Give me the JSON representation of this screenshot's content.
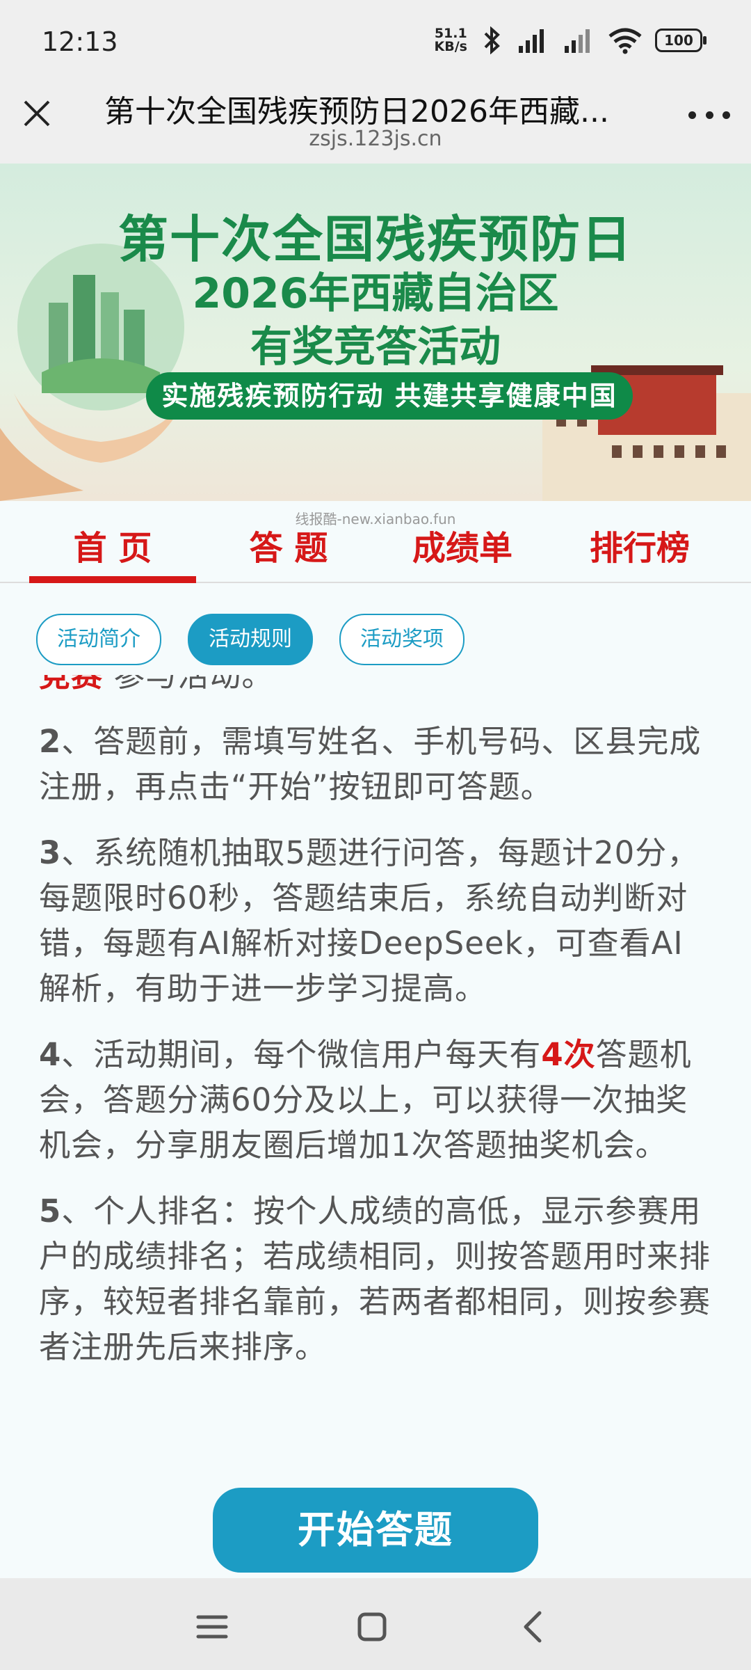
{
  "status": {
    "time": "12:13",
    "net_speed_value": "51.1",
    "net_speed_unit": "KB/s",
    "battery": "100"
  },
  "titlebar": {
    "title": "第十次全国残疾预防日2026年西藏...",
    "url": "zsjs.123js.cn"
  },
  "banner": {
    "line1": "第十次全国残疾预防日",
    "line2": "2026年西藏自治区",
    "line3": "有奖竞答活动",
    "slogan": "实施残疾预防行动 共建共享健康中国"
  },
  "watermark": "线报酷-new.xianbao.fun",
  "tabs": [
    {
      "label": "首 页",
      "active": true
    },
    {
      "label": "答 题",
      "active": false
    },
    {
      "label": "成绩单",
      "active": false
    },
    {
      "label": "排行榜",
      "active": false
    }
  ],
  "pills": [
    {
      "label": "活动简介",
      "active": false
    },
    {
      "label": "活动规则",
      "active": true
    },
    {
      "label": "活动奖项",
      "active": false
    }
  ],
  "content": {
    "partial_red": "竞赛",
    "partial_text": " 参与活动。",
    "rules": [
      {
        "num": "2",
        "text": "、答题前，需填写姓名、手机号码、区县完成注册，再点击“开始”按钮即可答题。"
      },
      {
        "num": "3",
        "text": "、系统随机抽取5题进行问答，每题计20分，每题限时60秒，答题结束后，系统自动判断对错，每题有AI解析对接DeepSeek，可查看AI解析，有助于进一步学习提高。"
      },
      {
        "num": "4",
        "text_before": "、活动期间，每个微信用户每天有",
        "highlight": "4次",
        "text_after": "答题机会，答题分满60分及以上，可以获得一次抽奖机会，分享朋友圈后增加1次答题抽奖机会。"
      },
      {
        "num": "5",
        "text": "、个人排名：按个人成绩的高低，显示参赛用户的成绩排名；若成绩相同，则按答题用时来排序，较短者排名靠前，若两者都相同，则按参赛者注册先后来排序。"
      }
    ]
  },
  "start_button": "开始答题",
  "colors": {
    "accent_blue": "#1c9cc4",
    "accent_red": "#d61818",
    "banner_green": "#1a8a4a"
  }
}
